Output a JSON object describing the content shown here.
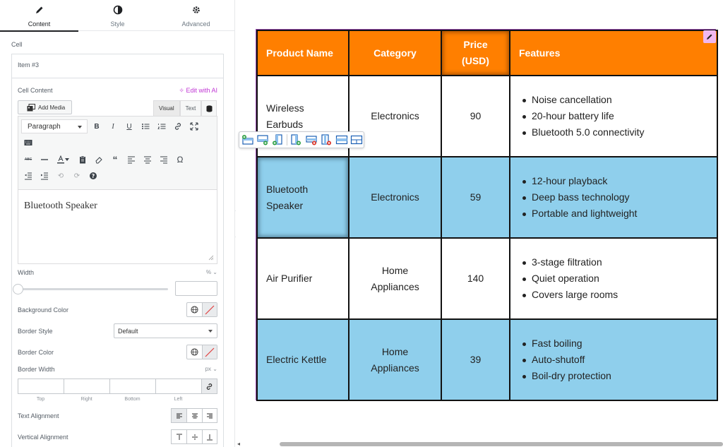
{
  "tabs": [
    {
      "label": "Content",
      "icon": "pencil-icon",
      "active": true
    },
    {
      "label": "Style",
      "icon": "contrast-icon",
      "active": false
    },
    {
      "label": "Advanced",
      "icon": "gear-icon",
      "active": false
    }
  ],
  "panel": {
    "section_label": "Cell",
    "item_title": "Item #3",
    "cell_content_label": "Cell Content",
    "edit_ai": "Edit with AI",
    "add_media": "Add Media",
    "editor_tabs": {
      "visual": "Visual",
      "text": "Text"
    },
    "paragraph_select": "Paragraph",
    "editor_content": "Bluetooth Speaker",
    "width_label": "Width",
    "width_unit": "%",
    "width_value": "",
    "background_color_label": "Background Color",
    "border_style_label": "Border Style",
    "border_style_value": "Default",
    "border_color_label": "Border Color",
    "border_width_label": "Border Width",
    "border_width_unit": "px",
    "dimension_labels": [
      "Top",
      "Right",
      "Bottom",
      "Left"
    ],
    "text_alignment_label": "Text Alignment",
    "vertical_alignment_label": "Vertical Alignment"
  },
  "colors": {
    "header_orange": "#ff7f00",
    "row_blue": "#8fcfec",
    "ai_purple": "#c036d4",
    "widget_outline": "#9a4bb3"
  },
  "table": {
    "headers": [
      "Product Name",
      "Category",
      "Price (USD)",
      "Features"
    ],
    "header_price_lines": [
      "Price",
      "(USD)"
    ],
    "rows": [
      {
        "name": "Wireless Earbuds",
        "category": "Electronics",
        "price": "90",
        "features": [
          "Noise cancellation",
          "20-hour battery life",
          "Bluetooth 5.0 connectivity"
        ]
      },
      {
        "name": "Bluetooth Speaker",
        "category": "Electronics",
        "price": "59",
        "features": [
          "12-hour playback",
          "Deep bass technology",
          "Portable and lightweight"
        ]
      },
      {
        "name": "Air Purifier",
        "category": "Home Appliances",
        "price": "140",
        "features": [
          "3-stage filtration",
          "Quiet operation",
          "Covers large rooms"
        ]
      },
      {
        "name": "Electric Kettle",
        "category": "Home Appliances",
        "price": "39",
        "features": [
          "Fast boiling",
          "Auto-shutoff",
          "Boil-dry protection"
        ]
      }
    ]
  },
  "table_toolbar_icons": [
    "insert-row-above-icon",
    "insert-row-below-icon",
    "insert-column-left-icon",
    "insert-column-right-icon",
    "delete-row-icon",
    "delete-column-icon",
    "merge-cells-icon",
    "split-cells-icon"
  ]
}
